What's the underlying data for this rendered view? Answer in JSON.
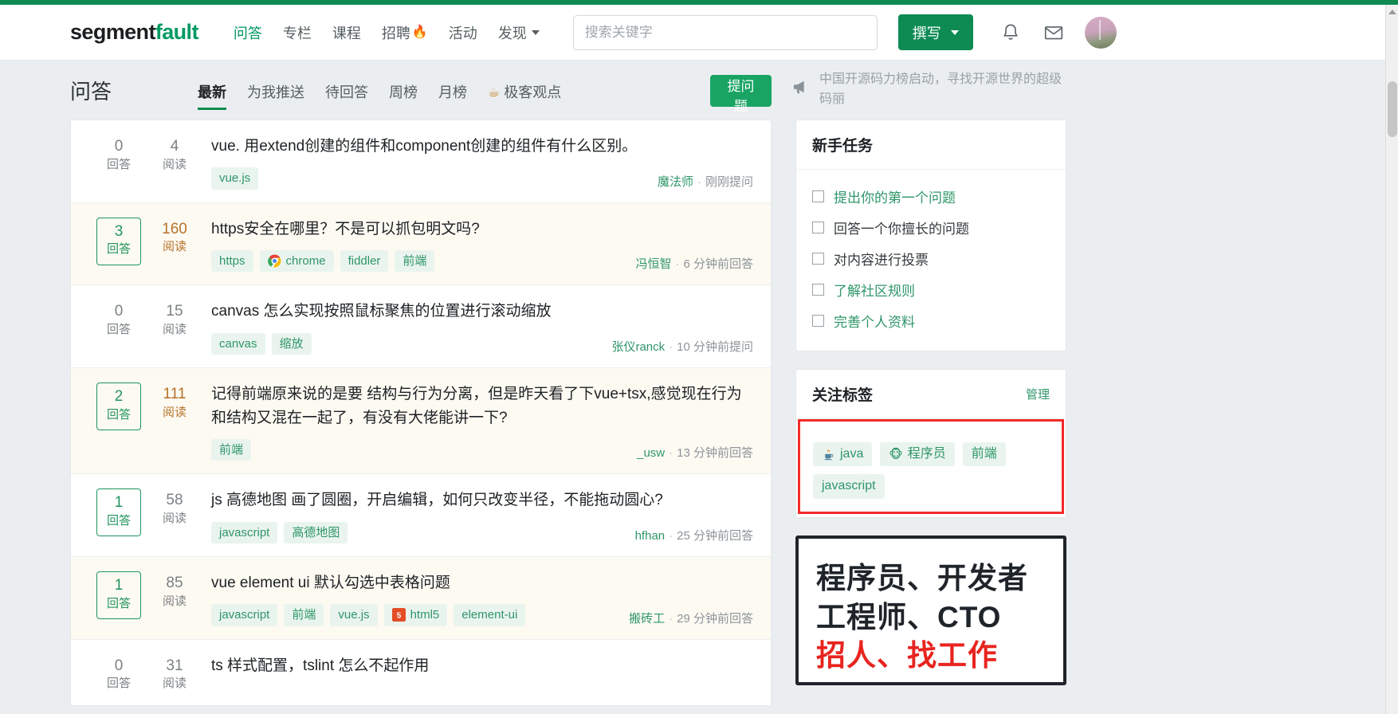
{
  "brand": {
    "part1": "segment",
    "part2": "fault"
  },
  "nav": [
    {
      "label": "问答",
      "active": true,
      "icon": null
    },
    {
      "label": "专栏",
      "active": false,
      "icon": null
    },
    {
      "label": "课程",
      "active": false,
      "icon": null
    },
    {
      "label": "招聘",
      "active": false,
      "icon": "fire-icon"
    },
    {
      "label": "活动",
      "active": false,
      "icon": null
    },
    {
      "label": "发现",
      "active": false,
      "icon": "chevron-down-icon"
    }
  ],
  "search": {
    "placeholder": "搜索关键字",
    "value": ""
  },
  "compose": {
    "label": "撰写"
  },
  "header_icons": {
    "bell": "bell-icon",
    "mail": "envelope-icon",
    "avatar": "user-avatar"
  },
  "toolbar": {
    "page_title": "问答",
    "ask_label": "提问题",
    "tabs": [
      {
        "label": "最新",
        "active": true,
        "icon": null
      },
      {
        "label": "为我推送",
        "active": false,
        "icon": null
      },
      {
        "label": "待回答",
        "active": false,
        "icon": null
      },
      {
        "label": "周榜",
        "active": false,
        "icon": null
      },
      {
        "label": "月榜",
        "active": false,
        "icon": null
      },
      {
        "label": "极客观点",
        "active": false,
        "icon": "coffee-cup-icon"
      }
    ],
    "announcement": "中国开源码力榜启动，寻找开源世界的超级码丽"
  },
  "questions": [
    {
      "answers": "0",
      "answers_label": "回答",
      "boxed": false,
      "views": "4",
      "views_label": "阅读",
      "warm": false,
      "title": "vue. 用extend创建的组件和component创建的组件有什么区别。",
      "tags": [
        {
          "label": "vue.js",
          "icon": null
        }
      ],
      "author": "魔法师",
      "time": "刚刚提问",
      "highlight": false
    },
    {
      "answers": "3",
      "answers_label": "回答",
      "boxed": true,
      "views": "160",
      "views_label": "阅读",
      "warm": true,
      "title": "https安全在哪里？不是可以抓包明文吗?",
      "tags": [
        {
          "label": "https",
          "icon": null
        },
        {
          "label": "chrome",
          "icon": "chrome-icon"
        },
        {
          "label": "fiddler",
          "icon": null
        },
        {
          "label": "前端",
          "icon": null
        }
      ],
      "author": "冯恒智",
      "time": "6 分钟前回答",
      "highlight": true
    },
    {
      "answers": "0",
      "answers_label": "回答",
      "boxed": false,
      "views": "15",
      "views_label": "阅读",
      "warm": false,
      "title": "canvas 怎么实现按照鼠标聚焦的位置进行滚动缩放",
      "tags": [
        {
          "label": "canvas",
          "icon": null
        },
        {
          "label": "缩放",
          "icon": null
        }
      ],
      "author": "张仪ranck",
      "time": "10 分钟前提问",
      "highlight": false
    },
    {
      "answers": "2",
      "answers_label": "回答",
      "boxed": true,
      "views": "111",
      "views_label": "阅读",
      "warm": true,
      "title": "记得前端原来说的是要 结构与行为分离，但是昨天看了下vue+tsx,感觉现在行为和结构又混在一起了，有没有大佬能讲一下?",
      "tags": [
        {
          "label": "前端",
          "icon": null
        }
      ],
      "author": "_usw",
      "time": "13 分钟前回答",
      "highlight": true
    },
    {
      "answers": "1",
      "answers_label": "回答",
      "boxed": true,
      "views": "58",
      "views_label": "阅读",
      "warm": false,
      "title": "js 高德地图 画了圆圈，开启编辑，如何只改变半径，不能拖动圆心?",
      "tags": [
        {
          "label": "javascript",
          "icon": null
        },
        {
          "label": "高德地图",
          "icon": null
        }
      ],
      "author": "hfhan",
      "time": "25 分钟前回答",
      "highlight": false
    },
    {
      "answers": "1",
      "answers_label": "回答",
      "boxed": true,
      "views": "85",
      "views_label": "阅读",
      "warm": false,
      "title": "vue element ui 默认勾选中表格问题",
      "tags": [
        {
          "label": "javascript",
          "icon": null
        },
        {
          "label": "前端",
          "icon": null
        },
        {
          "label": "vue.js",
          "icon": null
        },
        {
          "label": "html5",
          "icon": "html5-icon"
        },
        {
          "label": "element-ui",
          "icon": null
        }
      ],
      "author": "搬砖工",
      "time": "29 分钟前回答",
      "highlight": true
    },
    {
      "answers": "0",
      "answers_label": "回答",
      "boxed": false,
      "views": "31",
      "views_label": "阅读",
      "warm": false,
      "title": "ts 样式配置，tslint 怎么不起作用",
      "tags": [],
      "author": "",
      "time": "",
      "highlight": false
    }
  ],
  "sidebar": {
    "tasks_card": {
      "title": "新手任务",
      "items": [
        {
          "label": "提出你的第一个问题",
          "style": "link"
        },
        {
          "label": "回答一个你擅长的问题",
          "style": "plain"
        },
        {
          "label": "对内容进行投票",
          "style": "plain"
        },
        {
          "label": "了解社区规则",
          "style": "link"
        },
        {
          "label": "完善个人资料",
          "style": "link"
        }
      ]
    },
    "tags_card": {
      "title": "关注标签",
      "manage_label": "管理",
      "tags": [
        {
          "label": "java",
          "icon": "java-coffee-icon"
        },
        {
          "label": "程序员",
          "icon": "monkey-icon"
        },
        {
          "label": "前端",
          "icon": null
        },
        {
          "label": "javascript",
          "icon": null
        }
      ]
    },
    "ad": {
      "line1": "程序员、开发者",
      "line2": "工程师、CTO",
      "line3": "招人、找工作"
    }
  },
  "colors": {
    "brand_green": "#009a61",
    "accent_green": "#0f8b51",
    "warm_orange": "#b5732a",
    "highlight_row": "#fdfaf2",
    "highlight_border": "#f42b2b",
    "page_bg": "#ebeef0"
  }
}
